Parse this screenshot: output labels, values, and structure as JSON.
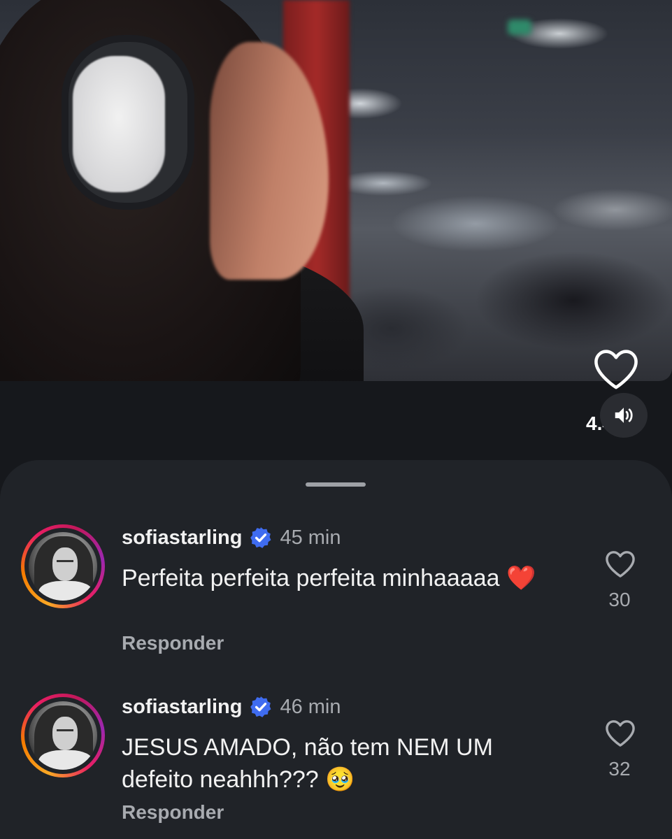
{
  "video": {
    "like_count": "4.406"
  },
  "comments": [
    {
      "username": "sofiastarling",
      "time": "45 min",
      "text": "Perfeita perfeita perfeita minhaaaaa ❤️",
      "reply_label": "Responder",
      "likes": "30"
    },
    {
      "username": "sofiastarling",
      "time": "46 min",
      "text": "JESUS AMADO, não tem NEM UM defeito neahhh??? 🥹",
      "reply_label": "Responder",
      "likes": "32"
    }
  ],
  "colors": {
    "background": "#16181c",
    "sheet": "#202328",
    "verified": "#3f6cf0",
    "muted_text": "#a8abb0"
  },
  "icons": [
    "heart-icon",
    "speaker-icon",
    "verified-badge-icon",
    "avatar"
  ]
}
